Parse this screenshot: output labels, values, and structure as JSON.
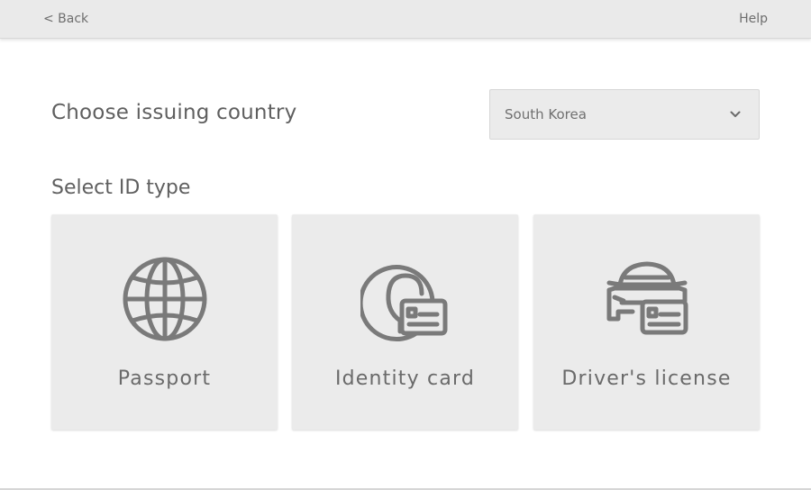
{
  "topbar": {
    "back_label": "< Back",
    "help_label": "Help"
  },
  "country": {
    "heading": "Choose issuing country",
    "selected": "South Korea"
  },
  "id_type": {
    "heading": "Select ID type",
    "options": [
      {
        "label": "Passport",
        "icon": "globe-icon"
      },
      {
        "label": "Identity card",
        "icon": "id-card-icon"
      },
      {
        "label": "Driver's license",
        "icon": "car-license-icon"
      }
    ]
  },
  "colors": {
    "icon": "#7a7a7a",
    "card_bg": "#ebebeb",
    "topbar_bg": "#eaeaea"
  }
}
